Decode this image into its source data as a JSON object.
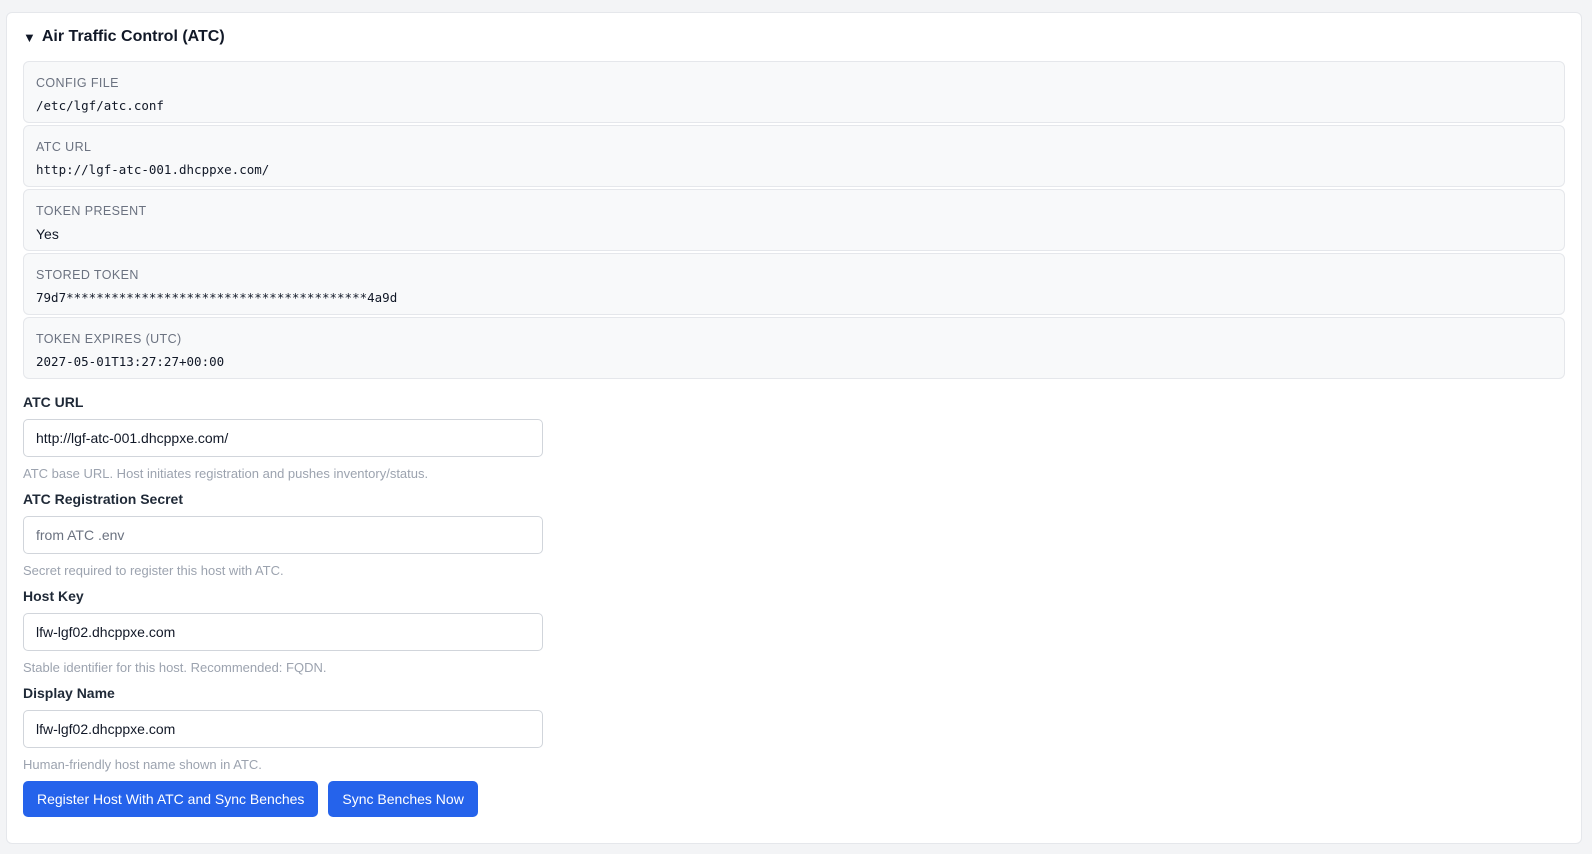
{
  "section": {
    "title": "Air Traffic Control (ATC)",
    "toggle_glyph": "▼"
  },
  "info": [
    {
      "key": "CONFIG FILE",
      "value": "/etc/lgf/atc.conf"
    },
    {
      "key": "ATC URL",
      "value": "http://lgf-atc-001.dhcppxe.com/"
    },
    {
      "key": "TOKEN PRESENT",
      "value": "Yes"
    },
    {
      "key": "STORED TOKEN",
      "value": "79d7****************************************4a9d"
    },
    {
      "key": "TOKEN EXPIRES (UTC)",
      "value": "2027-05-01T13:27:27+00:00"
    }
  ],
  "form": {
    "atc_url": {
      "label": "ATC URL",
      "value": "http://lgf-atc-001.dhcppxe.com/",
      "help": "ATC base URL. Host initiates registration and pushes inventory/status."
    },
    "registration_secret": {
      "label": "ATC Registration Secret",
      "value": "",
      "placeholder": "from ATC .env",
      "help": "Secret required to register this host with ATC."
    },
    "host_key": {
      "label": "Host Key",
      "value": "lfw-lgf02.dhcppxe.com",
      "help": "Stable identifier for this host. Recommended: FQDN."
    },
    "display_name": {
      "label": "Display Name",
      "value": "lfw-lgf02.dhcppxe.com",
      "help": "Human-friendly host name shown in ATC."
    }
  },
  "buttons": {
    "register": "Register Host With ATC and Sync Benches",
    "sync": "Sync Benches Now"
  },
  "colors": {
    "primary": "#2563eb",
    "page_bg": "#f3f4f6",
    "card_bg": "#f8f9fa",
    "help_text": "#9ca3af"
  }
}
